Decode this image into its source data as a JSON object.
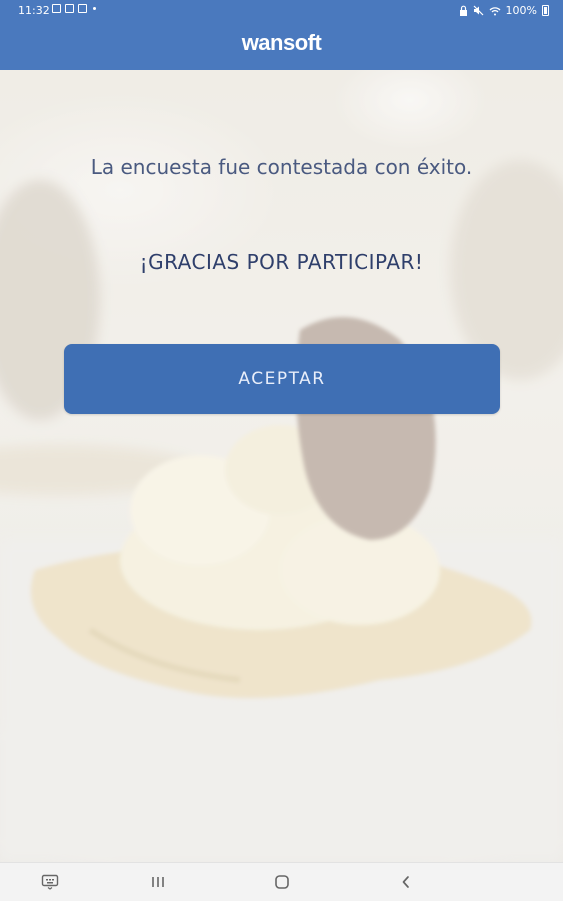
{
  "status_bar": {
    "time": "11:32",
    "battery": "100%"
  },
  "header": {
    "brand": "wansoft",
    "color": "#4a79be"
  },
  "content": {
    "message": "La encuesta fue contestada con éxito.",
    "thanks": "¡GRACIAS POR PARTICIPAR!",
    "accept_button": "ACEPTAR",
    "button_color": "#3f6fb4"
  },
  "nav_bar": {
    "icons": [
      "keyboard-icon",
      "recents-icon",
      "home-icon",
      "back-icon"
    ]
  }
}
